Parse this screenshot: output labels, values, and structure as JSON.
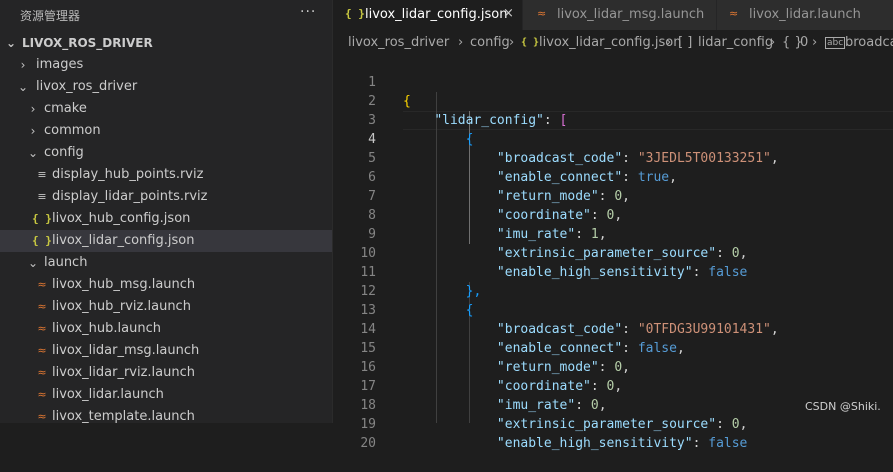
{
  "explorer": {
    "title": "资源管理器",
    "more": "···",
    "root": "LIVOX_ROS_DRIVER",
    "items": [
      {
        "label": "images",
        "chev": "›"
      },
      {
        "label": "livox_ros_driver",
        "chev": "⌄"
      },
      {
        "label": "cmake",
        "chev": "›"
      },
      {
        "label": "common",
        "chev": "›"
      },
      {
        "label": "config",
        "chev": "⌄"
      },
      {
        "label": "display_hub_points.rviz"
      },
      {
        "label": "display_lidar_points.rviz"
      },
      {
        "label": "livox_hub_config.json"
      },
      {
        "label": "livox_lidar_config.json"
      },
      {
        "label": "launch",
        "chev": "⌄"
      },
      {
        "label": "livox_hub_msg.launch"
      },
      {
        "label": "livox_hub_rviz.launch"
      },
      {
        "label": "livox_hub.launch"
      },
      {
        "label": "livox_lidar_msg.launch"
      },
      {
        "label": "livox_lidar_rviz.launch"
      },
      {
        "label": "livox_lidar.launch"
      },
      {
        "label": "livox_template.launch"
      }
    ],
    "icons": {
      "json": "{ }",
      "launch": "≈",
      "text": "≡"
    }
  },
  "tabs": [
    {
      "label": "livox_lidar_config.json",
      "icon": "{ }",
      "close": "×"
    },
    {
      "label": "livox_lidar_msg.launch",
      "icon": "≈"
    },
    {
      "label": "livox_lidar.launch",
      "icon": "≈"
    }
  ],
  "breadcrumb": {
    "p1": "livox_ros_driver",
    "sep": "›",
    "p2": "config",
    "p3icon": "{ }",
    "p3": "livox_lidar_config.json",
    "p4icon": "[ ]",
    "p4": "lidar_config",
    "p5icon": "{ }",
    "p5": "0",
    "p6icon": "abc",
    "p6": "broadcast_code"
  },
  "editor": {
    "line_numbers": [
      "1",
      "2",
      "3",
      "4",
      "5",
      "6",
      "7",
      "8",
      "9",
      "10",
      "11",
      "12",
      "13",
      "14",
      "15",
      "16",
      "17",
      "18",
      "19",
      "20"
    ],
    "current_line": "4",
    "code": {
      "l1_open": "{",
      "l2_key": "\"lidar_config\"",
      "l2_colon": ": ",
      "l2_bracket": "[",
      "obj_open": "{",
      "obj_close": "},",
      "k_bc": "\"broadcast_code\"",
      "k_ec": "\"enable_connect\"",
      "k_rm": "\"return_mode\"",
      "k_co": "\"coordinate\"",
      "k_ir": "\"imu_rate\"",
      "k_eps": "\"extrinsic_parameter_source\"",
      "k_ehs": "\"enable_high_sensitivity\"",
      "colon": ": ",
      "comma": ",",
      "v1_bc": "\"3JEDL5T00133251\"",
      "v1_ec": "true",
      "v1_rm": "0",
      "v1_co": "0",
      "v1_ir": "1",
      "v1_eps": "0",
      "v1_ehs": "false",
      "v2_bc": "\"0TFDG3U99101431\"",
      "v2_ec": "false",
      "v2_rm": "0",
      "v2_co": "0",
      "v2_ir": "0",
      "v2_eps": "0",
      "v2_ehs": "false"
    }
  },
  "watermark": "CSDN @Shiki."
}
